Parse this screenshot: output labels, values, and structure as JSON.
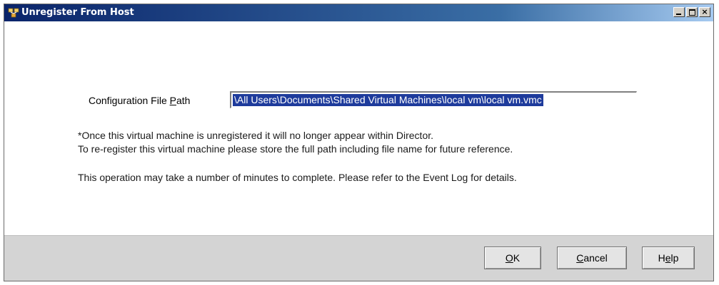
{
  "window": {
    "title": "Unregister From Host",
    "controls": {
      "minimize": "_",
      "maximize": "□",
      "close": "×"
    }
  },
  "form": {
    "config_label_pre": "Configuration File ",
    "config_label_mnemonic": "P",
    "config_label_post": "ath",
    "config_value": "\\All Users\\Documents\\Shared Virtual Machines\\local vm\\local vm.vmc"
  },
  "messages": {
    "line1": "*Once this virtual machine is unregistered it will no longer appear within Director.",
    "line2": "To re-register this virtual machine please store the full path including file name for future reference.",
    "line3": "This operation may take a number of minutes to complete. Please refer to the Event Log for details."
  },
  "buttons": {
    "ok": {
      "mnemonic": "O",
      "rest": "K"
    },
    "cancel": {
      "mnemonic": "C",
      "rest": "ancel"
    },
    "help": {
      "pre": "H",
      "mnemonic": "e",
      "rest": "lp"
    }
  },
  "icons": {
    "title_icon": "director-host-icon"
  }
}
